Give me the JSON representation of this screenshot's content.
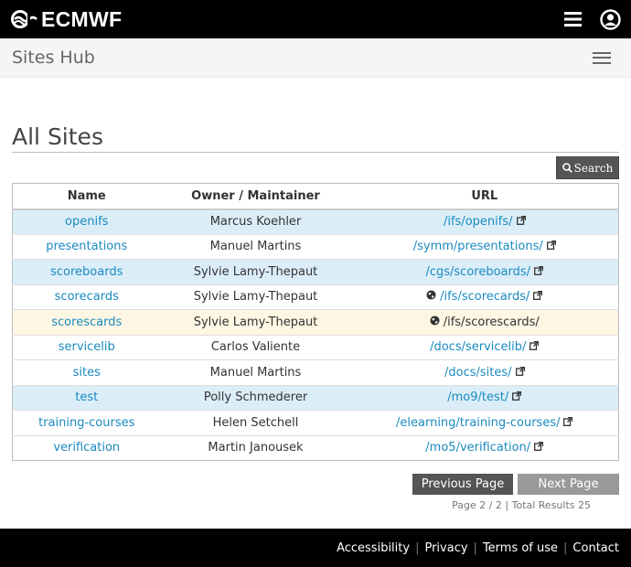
{
  "brand": {
    "logo_text": "ECMWF"
  },
  "header": {
    "icons": [
      "menu-icon",
      "user-icon"
    ]
  },
  "subheader": {
    "title": "Sites Hub"
  },
  "main": {
    "title": "All Sites",
    "search_label": "Search",
    "columns": [
      "Name",
      "Owner / Maintainer",
      "URL"
    ],
    "rows": [
      {
        "name": "openifs",
        "owner": "Marcus Koehler",
        "url": "/ifs/openifs/",
        "globe": false,
        "external": true,
        "style": "blue"
      },
      {
        "name": "presentations",
        "owner": "Manuel Martins",
        "url": "/symm/presentations/",
        "globe": false,
        "external": true,
        "style": "plain"
      },
      {
        "name": "scoreboards",
        "owner": "Sylvie Lamy-Thepaut",
        "url": "/cgs/scoreboards/",
        "globe": false,
        "external": true,
        "style": "blue"
      },
      {
        "name": "scorecards",
        "owner": "Sylvie Lamy-Thepaut",
        "url": "/ifs/scorecards/",
        "globe": true,
        "external": true,
        "style": "plain"
      },
      {
        "name": "scorescards",
        "owner": "Sylvie Lamy-Thepaut",
        "url": "/ifs/scorescards/",
        "globe": true,
        "external": false,
        "style": "warn"
      },
      {
        "name": "servicelib",
        "owner": "Carlos Valiente",
        "url": "/docs/servicelib/",
        "globe": false,
        "external": true,
        "style": "plain"
      },
      {
        "name": "sites",
        "owner": "Manuel Martins",
        "url": "/docs/sites/",
        "globe": false,
        "external": true,
        "style": "plain"
      },
      {
        "name": "test",
        "owner": "Polly Schmederer",
        "url": "/mo9/test/",
        "globe": false,
        "external": true,
        "style": "blue"
      },
      {
        "name": "training-courses",
        "owner": "Helen Setchell",
        "url": "/elearning/training-courses/",
        "globe": false,
        "external": true,
        "style": "plain"
      },
      {
        "name": "verification",
        "owner": "Martin Janousek",
        "url": "/mo5/verification/",
        "globe": false,
        "external": true,
        "style": "plain"
      }
    ]
  },
  "pagination": {
    "prev_label": "Previous Page",
    "next_label": "Next Page",
    "info": "Page 2 / 2 | Total Results 25"
  },
  "footer": {
    "links": [
      "Accessibility",
      "Privacy",
      "Terms of use",
      "Contact"
    ]
  }
}
